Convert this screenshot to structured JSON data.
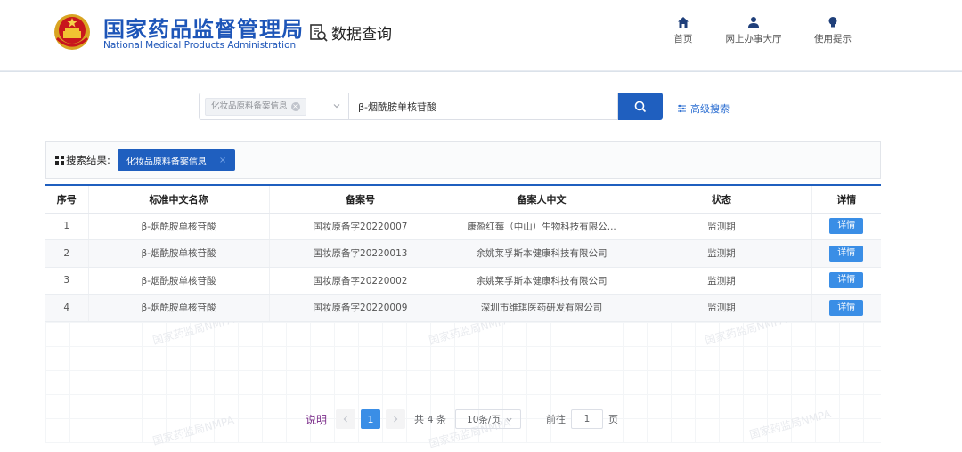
{
  "header": {
    "org_cn": "国家药品监督管理局",
    "org_en": "National Medical Products Administration",
    "data_query": "数据查询",
    "nav": [
      {
        "label": "首页",
        "icon": "home-icon"
      },
      {
        "label": "网上办事大厅",
        "icon": "user-icon"
      },
      {
        "label": "使用提示",
        "icon": "lightbulb-icon"
      }
    ]
  },
  "search": {
    "category_tag": "化妆品原料备案信息",
    "query_value": "β-烟酰胺单核苷酸",
    "advanced_label": "高级搜索"
  },
  "result": {
    "label": "搜索结果:",
    "tag": "化妆品原料备案信息"
  },
  "table": {
    "columns": [
      "序号",
      "标准中文名称",
      "备案号",
      "备案人中文",
      "状态",
      "详情"
    ],
    "rows": [
      {
        "index": "1",
        "name": "β-烟酰胺单核苷酸",
        "record_no": "国妆原备字20220007",
        "filer": "康盈红莓（中山）生物科技有限公...",
        "status": "监测期",
        "detail": "详情"
      },
      {
        "index": "2",
        "name": "β-烟酰胺单核苷酸",
        "record_no": "国妆原备字20220013",
        "filer": "余姚莱孚斯本健康科技有限公司",
        "status": "监测期",
        "detail": "详情"
      },
      {
        "index": "3",
        "name": "β-烟酰胺单核苷酸",
        "record_no": "国妆原备字20220002",
        "filer": "余姚莱孚斯本健康科技有限公司",
        "status": "监测期",
        "detail": "详情"
      },
      {
        "index": "4",
        "name": "β-烟酰胺单核苷酸",
        "record_no": "国妆原备字20220009",
        "filer": "深圳市维琪医药研发有限公司",
        "status": "监测期",
        "detail": "详情"
      }
    ]
  },
  "pagination": {
    "hint": "说明",
    "current_page": "1",
    "total": "共 4 条",
    "page_size": "10条/页",
    "goto_label": "前往",
    "goto_value": "1",
    "page_suffix": "页"
  },
  "watermark": "国家药监局NMPA",
  "colors": {
    "brand_blue": "#1d55b8",
    "button_blue": "#1f5fbf",
    "detail_blue": "#3a8ee6",
    "hint_purple": "#7b2d8a"
  }
}
